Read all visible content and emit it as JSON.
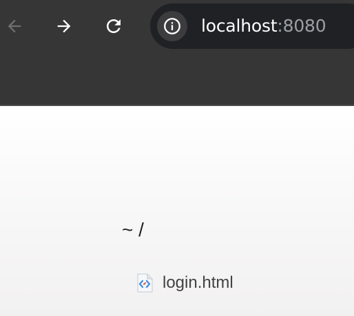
{
  "toolbar": {
    "back_icon": "arrow-left-icon",
    "forward_icon": "arrow-right-icon",
    "reload_icon": "reload-icon"
  },
  "omnibox": {
    "site_info_icon": "info-icon",
    "host": "localhost",
    "port": ":8080"
  },
  "listing": {
    "title": "~ /",
    "files": [
      {
        "name": "login.html",
        "icon": "html-file-icon"
      }
    ]
  },
  "colors": {
    "chrome_bg": "#363636",
    "omnibox_bg": "#202124",
    "url_host": "#ffffff",
    "url_port": "#9aa0a6",
    "file_icon_accent": "#4a90e2"
  }
}
